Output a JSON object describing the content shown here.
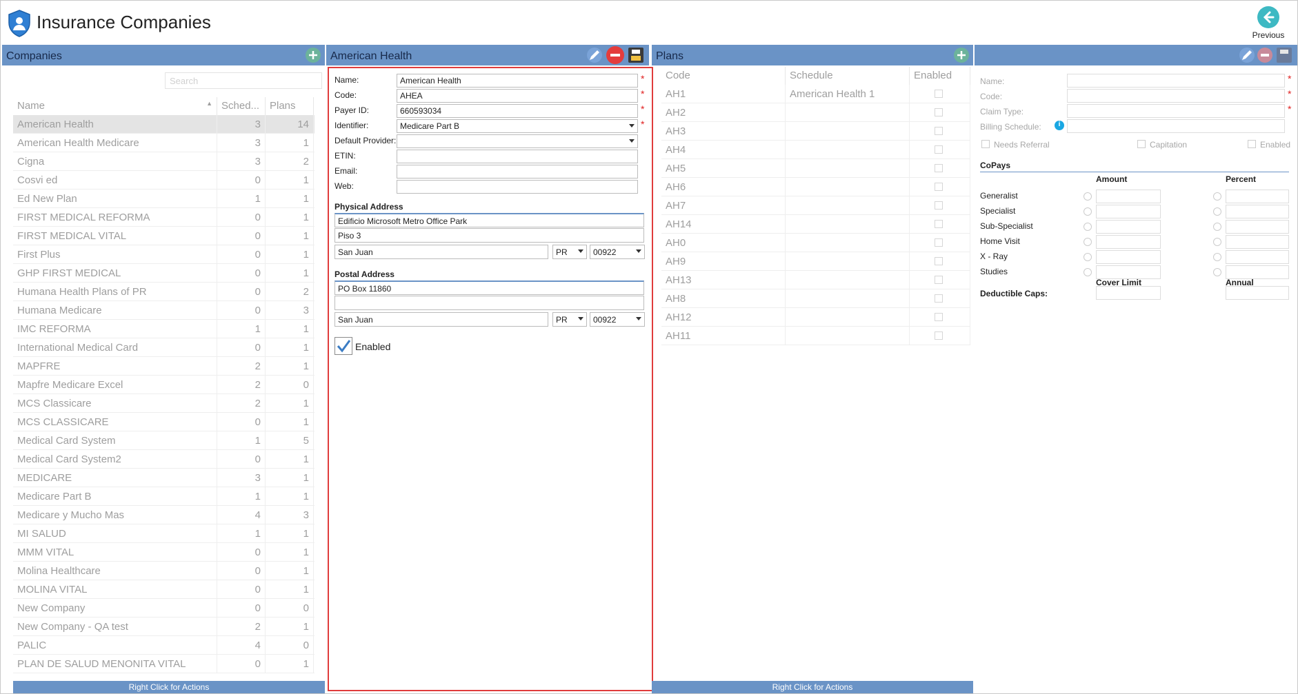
{
  "header": {
    "title": "Insurance Companies",
    "previous_label": "Previous"
  },
  "companies": {
    "bar_title": "Companies",
    "search_placeholder": "Search",
    "columns": {
      "name": "Name",
      "schedules": "Sched...",
      "plans": "Plans"
    },
    "rows": [
      {
        "name": "American Health",
        "schedules": "3",
        "plans": "14"
      },
      {
        "name": "American Health Medicare",
        "schedules": "3",
        "plans": "1"
      },
      {
        "name": "Cigna",
        "schedules": "3",
        "plans": "2"
      },
      {
        "name": "Cosvi ed",
        "schedules": "0",
        "plans": "1"
      },
      {
        "name": "Ed New Plan",
        "schedules": "1",
        "plans": "1"
      },
      {
        "name": "FIRST MEDICAL REFORMA",
        "schedules": "0",
        "plans": "1"
      },
      {
        "name": "FIRST MEDICAL VITAL",
        "schedules": "0",
        "plans": "1"
      },
      {
        "name": "First Plus",
        "schedules": "0",
        "plans": "1"
      },
      {
        "name": "GHP FIRST MEDICAL",
        "schedules": "0",
        "plans": "1"
      },
      {
        "name": "Humana Health Plans of PR",
        "schedules": "0",
        "plans": "2"
      },
      {
        "name": "Humana Medicare",
        "schedules": "0",
        "plans": "3"
      },
      {
        "name": "IMC REFORMA",
        "schedules": "1",
        "plans": "1"
      },
      {
        "name": "International Medical Card",
        "schedules": "0",
        "plans": "1"
      },
      {
        "name": "MAPFRE",
        "schedules": "2",
        "plans": "1"
      },
      {
        "name": "Mapfre Medicare Excel",
        "schedules": "2",
        "plans": "0"
      },
      {
        "name": "MCS Classicare",
        "schedules": "2",
        "plans": "1"
      },
      {
        "name": "MCS CLASSICARE",
        "schedules": "0",
        "plans": "1"
      },
      {
        "name": "Medical Card System",
        "schedules": "1",
        "plans": "5"
      },
      {
        "name": "Medical Card System2",
        "schedules": "0",
        "plans": "1"
      },
      {
        "name": "MEDICARE",
        "schedules": "3",
        "plans": "1"
      },
      {
        "name": "Medicare Part B",
        "schedules": "1",
        "plans": "1"
      },
      {
        "name": "Medicare y Mucho Mas",
        "schedules": "4",
        "plans": "3"
      },
      {
        "name": "MI SALUD",
        "schedules": "1",
        "plans": "1"
      },
      {
        "name": "MMM VITAL",
        "schedules": "0",
        "plans": "1"
      },
      {
        "name": "Molina Healthcare",
        "schedules": "0",
        "plans": "1"
      },
      {
        "name": "MOLINA VITAL",
        "schedules": "0",
        "plans": "1"
      },
      {
        "name": "New Company",
        "schedules": "0",
        "plans": "0"
      },
      {
        "name": "New Company - QA test",
        "schedules": "2",
        "plans": "1"
      },
      {
        "name": "PALIC",
        "schedules": "4",
        "plans": "0"
      },
      {
        "name": "PLAN DE SALUD MENONITA VITAL",
        "schedules": "0",
        "plans": "1"
      }
    ],
    "footer": "Right Click for Actions"
  },
  "detail": {
    "bar_title": "American Health",
    "fields": {
      "name_label": "Name:",
      "name_value": "American Health",
      "code_label": "Code:",
      "code_value": "AHEA",
      "payer_label": "Payer ID:",
      "payer_value": "660593034",
      "identifier_label": "Identifier:",
      "identifier_value": "Medicare Part B",
      "provider_label": "Default Provider:",
      "provider_value": "",
      "etin_label": "ETIN:",
      "etin_value": "",
      "email_label": "Email:",
      "email_value": "",
      "web_label": "Web:",
      "web_value": ""
    },
    "physical": {
      "title": "Physical Address",
      "line1": "Edificio Microsoft  Metro Office Park",
      "line2": "Piso 3",
      "city": "San Juan",
      "state": "PR",
      "zip": "00922"
    },
    "postal": {
      "title": "Postal Address",
      "line1": "PO Box 11860",
      "line2": "",
      "city": "San Juan",
      "state": "PR",
      "zip": "00922"
    },
    "enabled_label": "Enabled",
    "required_mark": "*"
  },
  "plans": {
    "bar_title": "Plans",
    "columns": {
      "code": "Code",
      "schedule": "Schedule",
      "enabled": "Enabled"
    },
    "rows": [
      {
        "code": "AH1",
        "schedule": "American Health 1"
      },
      {
        "code": "AH2",
        "schedule": ""
      },
      {
        "code": "AH3",
        "schedule": ""
      },
      {
        "code": "AH4",
        "schedule": ""
      },
      {
        "code": "AH5",
        "schedule": ""
      },
      {
        "code": "AH6",
        "schedule": ""
      },
      {
        "code": "AH7",
        "schedule": ""
      },
      {
        "code": "AH14",
        "schedule": ""
      },
      {
        "code": "AH0",
        "schedule": ""
      },
      {
        "code": "AH9",
        "schedule": ""
      },
      {
        "code": "AH13",
        "schedule": ""
      },
      {
        "code": "AH8",
        "schedule": ""
      },
      {
        "code": "AH12",
        "schedule": ""
      },
      {
        "code": "AH11",
        "schedule": ""
      }
    ],
    "footer": "Right Click for Actions"
  },
  "plan_detail": {
    "name_label": "Name:",
    "code_label": "Code:",
    "claim_label": "Claim Type:",
    "billing_label": "Billing Schedule:",
    "needs_referral": "Needs Referral",
    "capitation": "Capitation",
    "enabled": "Enabled",
    "copays_title": "CoPays",
    "amount": "Amount",
    "percent": "Percent",
    "copay_rows": [
      "Generalist",
      "Specialist",
      "Sub-Specialist",
      "Home Visit",
      "X - Ray",
      "Studies"
    ],
    "cover_limit": "Cover Limit",
    "annual": "Annual",
    "deductible": "Deductible Caps:"
  },
  "colors": {
    "bar": "#6a93c6",
    "accent": "#3eb9c3",
    "highlight": "#e03c3c"
  }
}
